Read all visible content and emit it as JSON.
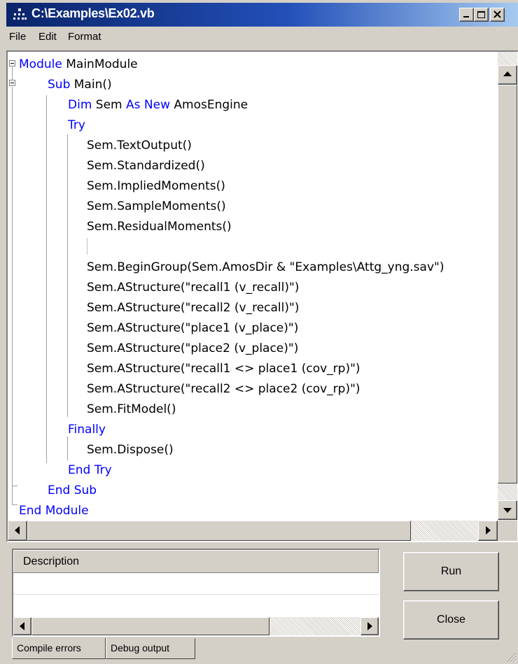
{
  "window": {
    "title": "C:\\Examples\\Ex02.vb",
    "accent": "#0a246a"
  },
  "menu": {
    "file": "File",
    "edit": "Edit",
    "format": "Format"
  },
  "code": {
    "lines": [
      {
        "kw": "Module ",
        "text": "MainModule"
      },
      {
        "kw": "Sub ",
        "text": "Main()"
      },
      {
        "kw": "Dim ",
        "text": "Sem ",
        "kw2": "As New ",
        "text2": "AmosEngine"
      },
      {
        "kw": "Try",
        "text": ""
      },
      {
        "kw": "",
        "text": "Sem.TextOutput()"
      },
      {
        "kw": "",
        "text": "Sem.Standardized()"
      },
      {
        "kw": "",
        "text": "Sem.ImpliedMoments()"
      },
      {
        "kw": "",
        "text": "Sem.SampleMoments()"
      },
      {
        "kw": "",
        "text": "Sem.ResidualMoments()"
      },
      {
        "kw": "",
        "text": ""
      },
      {
        "kw": "",
        "text": "Sem.BeginGroup(Sem.AmosDir & \"Examples\\Attg_yng.sav\")"
      },
      {
        "kw": "",
        "text": "Sem.AStructure(\"recall1 (v_recall)\")"
      },
      {
        "kw": "",
        "text": "Sem.AStructure(\"recall2 (v_recall)\")"
      },
      {
        "kw": "",
        "text": "Sem.AStructure(\"place1 (v_place)\")"
      },
      {
        "kw": "",
        "text": "Sem.AStructure(\"place2 (v_place)\")"
      },
      {
        "kw": "",
        "text": "Sem.AStructure(\"recall1 <> place1 (cov_rp)\")"
      },
      {
        "kw": "",
        "text": "Sem.AStructure(\"recall2 <> place2 (cov_rp)\")"
      },
      {
        "kw": "",
        "text": "Sem.FitModel()"
      },
      {
        "kw": "Finally",
        "text": ""
      },
      {
        "kw": "",
        "text": "Sem.Dispose()"
      },
      {
        "kw": "End Try",
        "text": ""
      },
      {
        "kw": "End Sub",
        "text": ""
      },
      {
        "kw": "End Module",
        "text": ""
      }
    ],
    "keyword_color": "#0000ff"
  },
  "errors": {
    "column_header": "Description",
    "tabs": [
      "Compile errors",
      "Debug output"
    ]
  },
  "buttons": {
    "run": "Run",
    "close": "Close"
  }
}
